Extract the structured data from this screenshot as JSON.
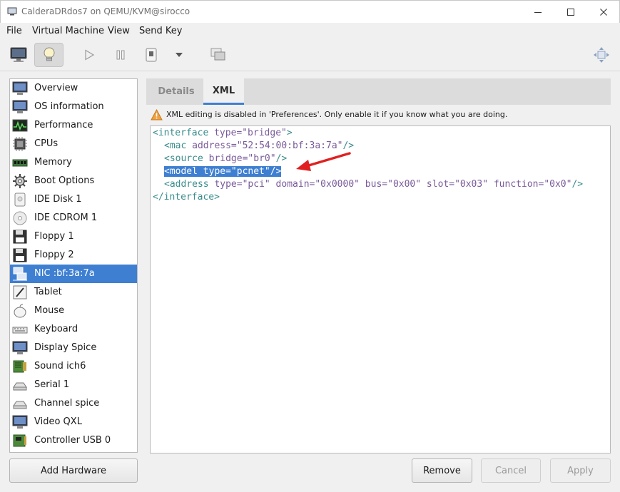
{
  "window": {
    "title": "CalderaDRdos7 on QEMU/KVM@sirocco",
    "minimize_icon": "minimize-icon",
    "maximize_icon": "maximize-icon",
    "close_icon": "close-icon"
  },
  "menu": {
    "items": [
      "File",
      "Virtual Machine",
      "View",
      "Send Key"
    ]
  },
  "toolbar": {
    "buttons": [
      "monitor-icon",
      "lightbulb-icon",
      "play-icon",
      "pause-icon",
      "stop-icon",
      "chevron-down-icon",
      "screenshot-icon",
      "move-icon"
    ],
    "active": "lightbulb-icon"
  },
  "sidebar": {
    "items": [
      {
        "label": "Overview",
        "icon": "monitor-icon"
      },
      {
        "label": "OS information",
        "icon": "monitor-icon"
      },
      {
        "label": "Performance",
        "icon": "chart-icon"
      },
      {
        "label": "CPUs",
        "icon": "cpu-icon"
      },
      {
        "label": "Memory",
        "icon": "memory-icon"
      },
      {
        "label": "Boot Options",
        "icon": "gear-icon"
      },
      {
        "label": "IDE Disk 1",
        "icon": "disk-icon"
      },
      {
        "label": "IDE CDROM 1",
        "icon": "cdrom-icon"
      },
      {
        "label": "Floppy 1",
        "icon": "floppy-icon"
      },
      {
        "label": "Floppy 2",
        "icon": "floppy-icon"
      },
      {
        "label": "NIC :bf:3a:7a",
        "icon": "network-icon"
      },
      {
        "label": "Tablet",
        "icon": "tablet-icon"
      },
      {
        "label": "Mouse",
        "icon": "mouse-icon"
      },
      {
        "label": "Keyboard",
        "icon": "keyboard-icon"
      },
      {
        "label": "Display Spice",
        "icon": "monitor-icon"
      },
      {
        "label": "Sound ich6",
        "icon": "sound-card-icon"
      },
      {
        "label": "Serial 1",
        "icon": "serial-icon"
      },
      {
        "label": "Channel spice",
        "icon": "serial-icon"
      },
      {
        "label": "Video QXL",
        "icon": "monitor-icon"
      },
      {
        "label": "Controller USB 0",
        "icon": "card-icon"
      }
    ],
    "selected": "NIC :bf:3a:7a"
  },
  "tabs": [
    {
      "label": "Details",
      "active": false
    },
    {
      "label": "XML",
      "active": true
    }
  ],
  "warning": {
    "icon": "warning-icon",
    "text": "XML editing is disabled in 'Preferences'. Only enable it if you know what you are doing."
  },
  "xml": {
    "line1": {
      "open": "<interface ",
      "attr": "type=",
      "val": "\"bridge\"",
      "close": ">"
    },
    "line2": {
      "open": "<mac ",
      "attr": "address=",
      "val": "\"52:54:00:bf:3a:7a\"",
      "close": "/>"
    },
    "line3": {
      "open": "<source ",
      "attr": "bridge=",
      "val": "\"br0\"",
      "close": "/>"
    },
    "line4": {
      "text": "<model type=\"pcnet\"/>"
    },
    "line5": {
      "open": "<address ",
      "a1": "type=",
      "v1": "\"pci\"",
      "a2": " domain=",
      "v2": "\"0x0000\"",
      "a3": " bus=",
      "v3": "\"0x00\"",
      "a4": " slot=",
      "v4": "\"0x03\"",
      "a5": " function=",
      "v5": "\"0x0\"",
      "close": "/>"
    },
    "line6": {
      "text": "</interface>"
    }
  },
  "annotation": {
    "color": "#e02020"
  },
  "buttons": {
    "add_hardware": "Add Hardware",
    "remove": "Remove",
    "cancel": "Cancel",
    "apply": "Apply"
  },
  "colors": {
    "accent": "#3e7fd1"
  }
}
